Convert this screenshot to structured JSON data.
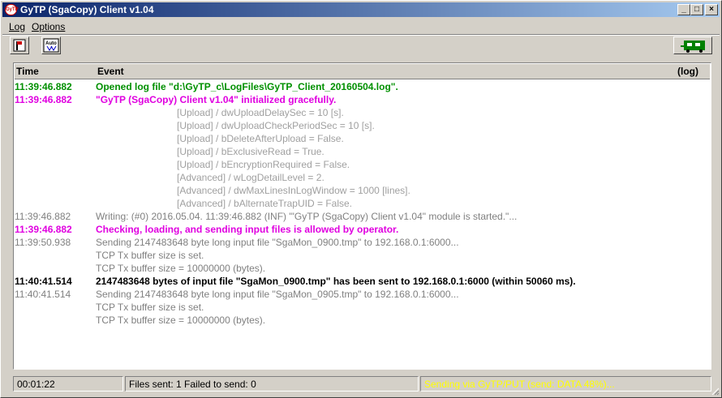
{
  "titlebar": {
    "app_icon_text": "GyTP",
    "title": "GyTP (SgaCopy) Client  v1.04",
    "minimize": "_",
    "maximize": "□",
    "close": "×"
  },
  "menu": [
    {
      "label": "Log",
      "underline_first": true
    },
    {
      "label": "Options",
      "underline_first": true
    }
  ],
  "toolbar": {
    "button1_icon": "flag-icon",
    "button2_label": "Auto",
    "right_icon": "connection-icon",
    "right_icon_color": "#008000"
  },
  "log": {
    "col_time": "Time",
    "col_event": "Event",
    "col_log": "(log)",
    "rows": [
      {
        "time": "11:39:46.882",
        "event": "Opened log file \"d:\\GyTP_c\\LogFiles\\GyTP_Client_20160504.log\".",
        "style": "green",
        "indent": false
      },
      {
        "time": "11:39:46.882",
        "event": "\"GyTP (SgaCopy) Client  v1.04\" initialized gracefully.",
        "style": "mag",
        "indent": false
      },
      {
        "time": "",
        "event": "[Upload] / dwUploadDelaySec = 10 [s].",
        "style": "lgray",
        "indent": true
      },
      {
        "time": "",
        "event": "[Upload] / dwUploadCheckPeriodSec = 10 [s].",
        "style": "lgray",
        "indent": true
      },
      {
        "time": "",
        "event": "[Upload] / bDeleteAfterUpload = False.",
        "style": "lgray",
        "indent": true
      },
      {
        "time": "",
        "event": "[Upload] / bExclusiveRead = True.",
        "style": "lgray",
        "indent": true
      },
      {
        "time": "",
        "event": "[Upload] / bEncryptionRequired = False.",
        "style": "lgray",
        "indent": true
      },
      {
        "time": "",
        "event": "[Advanced] / wLogDetailLevel = 2.",
        "style": "lgray",
        "indent": true
      },
      {
        "time": "",
        "event": "[Advanced] / dwMaxLinesInLogWindow = 1000 [lines].",
        "style": "lgray",
        "indent": true
      },
      {
        "time": "",
        "event": "[Advanced] / bAlternateTrapUID = False.",
        "style": "lgray",
        "indent": true
      },
      {
        "time": "11:39:46.882",
        "event": "Writing: (#0) 2016.05.04. 11:39:46.882 (INF) '\"GyTP (SgaCopy) Client  v1.04\" module is started.\"...",
        "style": "gray",
        "indent": false
      },
      {
        "time": "11:39:46.882",
        "event": "Checking, loading, and sending input files is allowed by operator.",
        "style": "mag",
        "indent": false
      },
      {
        "time": "11:39:50.938",
        "event": "Sending 2147483648 byte long input file \"SgaMon_0900.tmp\" to 192.168.0.1:6000...",
        "style": "gray",
        "indent": false
      },
      {
        "time": "",
        "event": "TCP Tx buffer size is set.",
        "style": "gray",
        "indent": false
      },
      {
        "time": "",
        "event": "TCP Tx buffer size = 10000000 (bytes).",
        "style": "gray",
        "indent": false
      },
      {
        "time": "11:40:41.514",
        "event": "2147483648 bytes of input file \"SgaMon_0900.tmp\" has been sent to 192.168.0.1:6000 (within 50060 ms).",
        "style": "black",
        "indent": false
      },
      {
        "time": "11:40:41.514",
        "event": "Sending 2147483648 byte long input file \"SgaMon_0905.tmp\" to 192.168.0.1:6000...",
        "style": "gray",
        "indent": false
      },
      {
        "time": "",
        "event": "TCP Tx buffer size is set.",
        "style": "gray",
        "indent": false
      },
      {
        "time": "",
        "event": "TCP Tx buffer size = 10000000 (bytes).",
        "style": "gray",
        "indent": false
      }
    ]
  },
  "statusbar": {
    "elapsed": "00:01:22",
    "files": "Files sent: 1    Failed to send: 0",
    "sending": "Sending via GyTP/PUT (send: DATA 48%)...",
    "sending_color": "#ffff00"
  }
}
